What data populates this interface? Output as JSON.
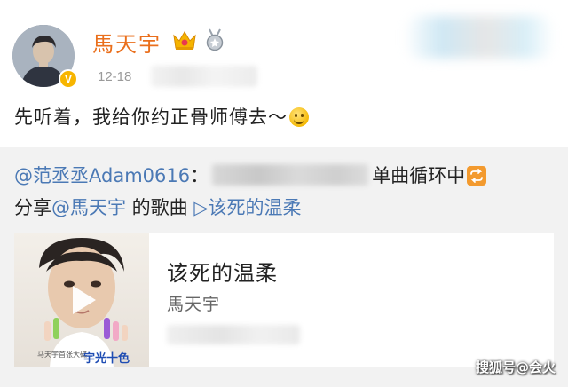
{
  "author": {
    "name": "馬天宇",
    "verified_icon": "verified-v-icon",
    "badges": [
      "crown-vip-icon",
      "medal-icon"
    ]
  },
  "post": {
    "time": "12-18",
    "text": "先听着，我给你约正骨师傅去～",
    "emoji": "smile-emoji"
  },
  "repost": {
    "mention": "@范丞丞Adam0616",
    "colon": "：",
    "suffix": "单曲循环中",
    "loop_icon": "repeat-icon",
    "share_prefix": "分享",
    "share_mention": "@馬天宇",
    "share_middle": " 的歌曲 ",
    "song_link": "▷该死的温柔"
  },
  "music_card": {
    "title": "该死的温柔",
    "artist": "馬天宇",
    "cover_icon": "play-icon",
    "cover_caption": "马天宇首张大碟",
    "cover_logo": "宇光十色"
  },
  "watermark": "搜狐号@会火",
  "colors": {
    "author_name": "#ea6f1c",
    "link": "#4b79b5",
    "repost_bg": "#f2f2f2",
    "verified": "#f7b500"
  }
}
